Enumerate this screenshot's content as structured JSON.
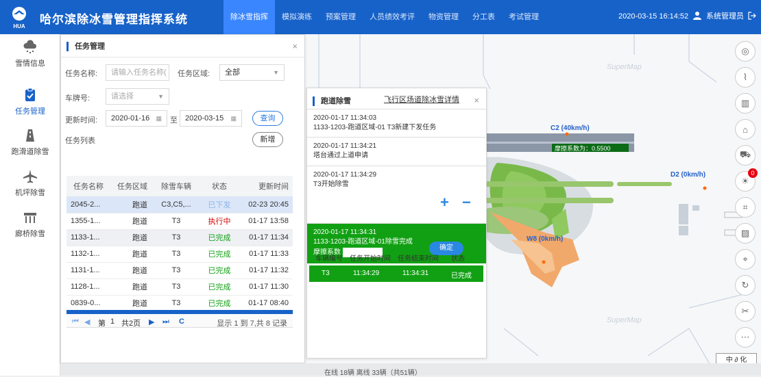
{
  "header": {
    "logo_text": "HUA",
    "title": "哈尔滨除冰雪管理指挥系统",
    "nav": [
      "除冰雪指挥",
      "模拟演练",
      "预案管理",
      "人员绩效考评",
      "物资管理",
      "分工表",
      "考试管理"
    ],
    "datetime": "2020-03-15 16:14:52",
    "user": "系统管理员"
  },
  "sidebar": {
    "items": [
      {
        "label": "雪情信息",
        "icon": "cloud-snow-icon"
      },
      {
        "label": "任务管理",
        "icon": "clipboard-icon"
      },
      {
        "label": "跑滑道除雪",
        "icon": "runway-icon"
      },
      {
        "label": "机坪除雪",
        "icon": "airplane-icon"
      },
      {
        "label": "廊桥除雪",
        "icon": "bridge-icon"
      }
    ]
  },
  "task_panel": {
    "title": "任务管理",
    "close": "×",
    "name_label": "任务名称:",
    "name_placeholder": "请输入任务名称(",
    "area_label": "任务区域:",
    "area_value": "全部",
    "plate_label": "车牌号:",
    "plate_placeholder": "请选择",
    "time_label": "更新时间:",
    "date_from": "2020-01-16",
    "to_label": "至",
    "date_to": "2020-03-15",
    "query_btn": "查询",
    "list_label": "任务列表",
    "add_btn": "新增",
    "columns": [
      "任务名称",
      "任务区域",
      "除雪车辆",
      "状态",
      "更新时间"
    ],
    "rows": [
      {
        "name": "2045-2...",
        "area": "跑道",
        "vehicle": "C3,C5,...",
        "status": "已下发",
        "time": "02-23 20:45"
      },
      {
        "name": "1355-1...",
        "area": "跑道",
        "vehicle": "T3",
        "status": "执行中",
        "time": "01-17 13:58"
      },
      {
        "name": "1133-1...",
        "area": "跑道",
        "vehicle": "T3",
        "status": "已完成",
        "time": "01-17 11:34"
      },
      {
        "name": "1132-1...",
        "area": "跑道",
        "vehicle": "T3",
        "status": "已完成",
        "time": "01-17 11:33"
      },
      {
        "name": "1131-1...",
        "area": "跑道",
        "vehicle": "T3",
        "status": "已完成",
        "time": "01-17 11:32"
      },
      {
        "name": "1128-1...",
        "area": "跑道",
        "vehicle": "T3",
        "status": "已完成",
        "time": "01-17 11:30"
      },
      {
        "name": "0839-0...",
        "area": "跑道",
        "vehicle": "T3",
        "status": "已完成",
        "time": "01-17 08:40"
      }
    ],
    "pager": {
      "first": "⏮",
      "prev": "◀",
      "page_pre": "第",
      "page": "1",
      "page_post": "共2页",
      "next": "▶",
      "last": "⏭",
      "refresh": "C",
      "summary": "显示 1 到 7,共 8 记录"
    }
  },
  "detail_panel": {
    "title": "跑道除雪",
    "subtitle": "飞行区场道除冰雪详情",
    "close": "×",
    "entries": [
      {
        "time": "2020-01-17 11:34:03",
        "text": "1133-1203-跑道区域-01 T3新建下发任务"
      },
      {
        "time": "2020-01-17 11:34:21",
        "text": "塔台通过上道申请"
      },
      {
        "time": "2020-01-17 11:34:29",
        "text": "T3开始除雪"
      }
    ],
    "plus": "+",
    "minus": "−",
    "active": {
      "time": "2020-01-17 11:34:31",
      "text": "1133-1203-跑道区域-01除雪完成",
      "friction_label": "摩擦系数",
      "confirm": "确定"
    },
    "vehicle_columns": [
      "车辆编号",
      "任务开始时间",
      "任务结束时间",
      "状态"
    ],
    "vehicle_rows": [
      {
        "id": "T3",
        "start": "11:34:29",
        "end": "11:34:31",
        "status": "已完成"
      }
    ]
  },
  "map": {
    "watermark": "SuperMap",
    "labels": {
      "c2": "C2 (40km/h)",
      "friction": "摩擦系数为：0.5500",
      "d2": "D2 (0km/h)",
      "w8": "W8 (0km/h)"
    },
    "badge": "0",
    "status_text": "在线 18辆   离线 33辆（共51辆）",
    "compass": "中 ∂ 化"
  },
  "colors": {
    "primary": "#1762c9",
    "green": "#11a013",
    "active_nav": "#3a86ff"
  }
}
